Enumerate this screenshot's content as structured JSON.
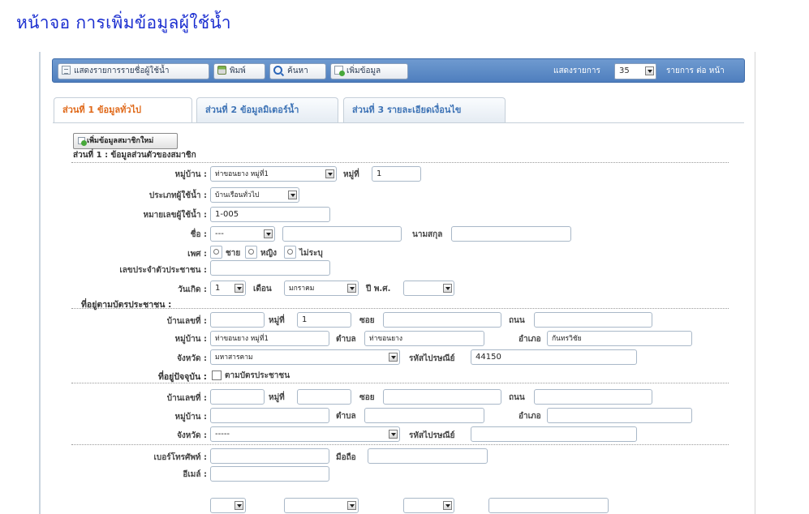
{
  "page_title": "หน้าจอ การเพิ่มข้อมูลผู้ใช้น้ำ",
  "toolbar": {
    "list_users": "แสดงรายการรายชื่อผู้ใช้น้ำ",
    "print": "พิมพ์",
    "search": "ค้นหา",
    "add": "เพิ่มข้อมูล",
    "show_label": "แสดงรายการ",
    "page_size": "35",
    "per_page_label": "รายการ ต่อ หน้า"
  },
  "tabs": [
    {
      "label": "ส่วนที่ 1 ข้อมูลทั่วไป",
      "active": true
    },
    {
      "label": "ส่วนที่ 2 ข้อมูลมิเตอร์น้ำ",
      "active": false
    },
    {
      "label": "ส่วนที่ 3 รายละเอียดเงื่อนไข",
      "active": false
    }
  ],
  "add_member_button": "เพิ่มข้อมูลสมาชิกใหม่",
  "section_title": "ส่วนที่ 1 : ข้อมูลส่วนตัวของสมาชิก",
  "form": {
    "village_label": "หมู่บ้าน :",
    "village_value": "ท่าขอนยาง หมู่ที่1",
    "moo_label": "หมู่ที่",
    "moo_value": "1",
    "user_type_label": "ประเภทผู้ใช้น้ำ :",
    "user_type_value": "บ้านเรือนทั่วไป",
    "user_no_label": "หมายเลขผู้ใช้น้ำ :",
    "user_no_value": "1-005",
    "name_label": "ชื่อ :",
    "prefix_value": "---",
    "surname_label": "นามสกุล",
    "gender_label": "เพศ :",
    "gender_options": [
      "ชาย",
      "หญิง",
      "ไม่ระบุ"
    ],
    "citizen_id_label": "เลขประจำตัวประชาชน :",
    "birth_label": "วันเกิด :",
    "birth_day": "1",
    "month_label": "เดือน",
    "birth_month": "มกราคม",
    "year_label": "ปี พ.ศ.",
    "id_address_heading": "ที่อยู่ตามบัตรประชาชน :",
    "house_no_label": "บ้านเลขที่ :",
    "addr_moo_label": "หมู่ที่",
    "addr_moo_value": "1",
    "soi_label": "ซอย",
    "road_label": "ถนน",
    "addr_village_label": "หมู่บ้าน :",
    "addr_village_value": "ท่าขอนยาง หมู่ที่1",
    "tambon_label": "ตำบล",
    "tambon_value": "ท่าขอนยาง",
    "amphoe_label": "อำเภอ",
    "amphoe_value": "กันทรวิชัย",
    "province_label": "จังหวัด :",
    "province_value": "มหาสารคาม",
    "postcode_label": "รหัสไปรษณีย์",
    "postcode_value": "44150",
    "current_address_label": "ที่อยู่ปัจจุบัน :",
    "same_as_id_label": "ตามบัตรประชาชน",
    "cur_house_no_label": "บ้านเลขที่ :",
    "cur_moo_label": "หมู่ที่",
    "cur_soi_label": "ซอย",
    "cur_road_label": "ถนน",
    "cur_village_label": "หมู่บ้าน :",
    "cur_tambon_label": "ตำบล",
    "cur_amphoe_label": "อำเภอ",
    "cur_province_label": "จังหวัด :",
    "cur_province_value": "-----",
    "cur_postcode_label": "รหัสไปรษณีย์",
    "phone_label": "เบอร์โทรศัพท์ :",
    "mobile_label": "มือถือ",
    "email_label": "อีเมล์ :"
  }
}
